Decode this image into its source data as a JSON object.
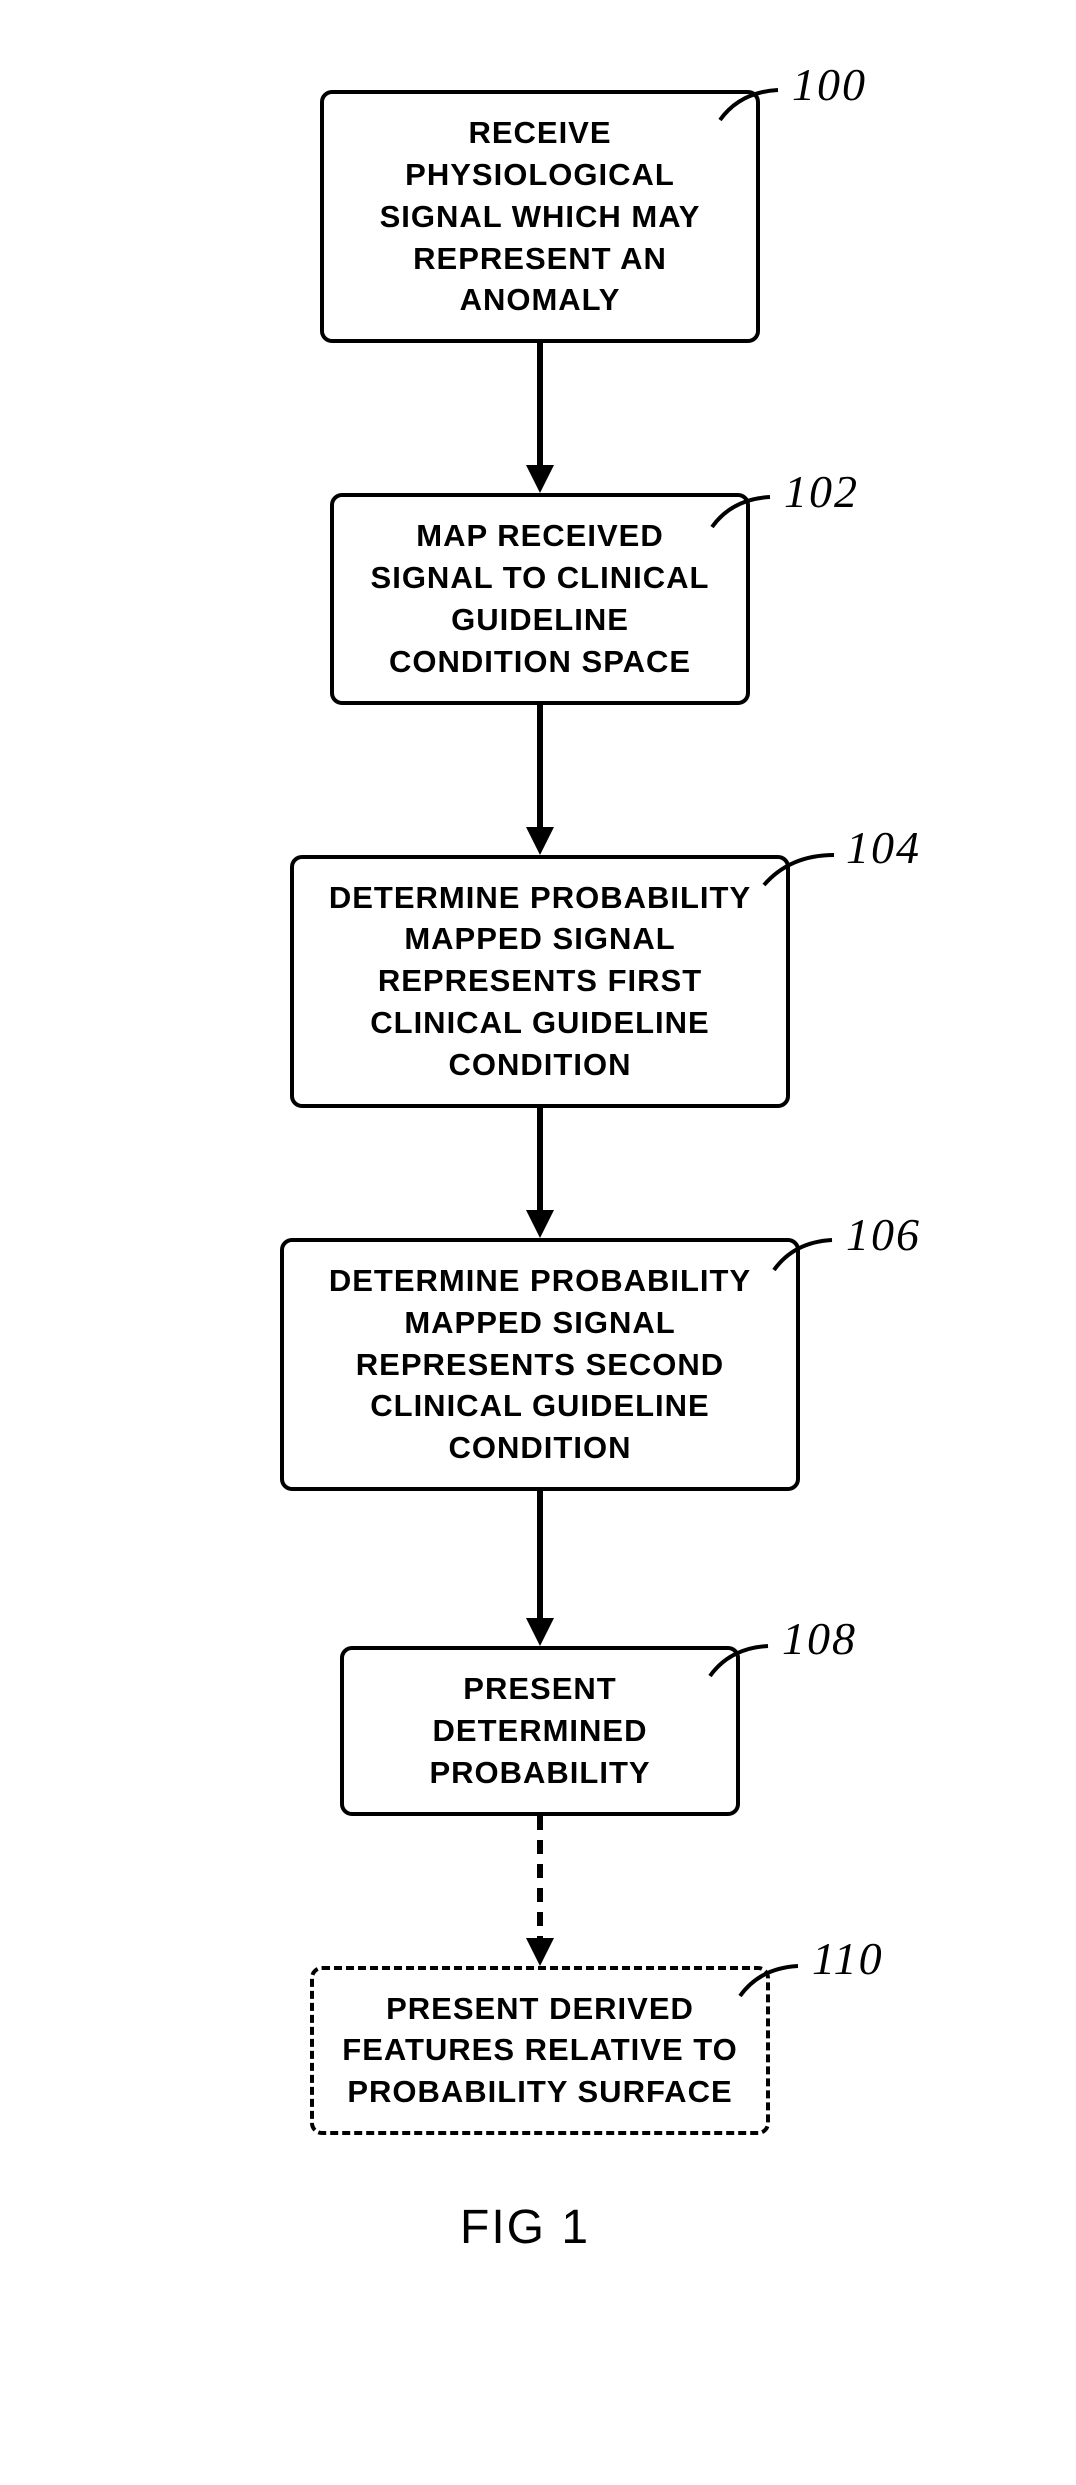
{
  "figure_caption": "FIG 1",
  "nodes": [
    {
      "id": "n100",
      "ref": "100",
      "text": "RECEIVE PHYSIOLOGICAL SIGNAL WHICH  MAY REPRESENT AN ANOMALY",
      "dashed": false
    },
    {
      "id": "n102",
      "ref": "102",
      "text": "MAP RECEIVED SIGNAL TO CLINICAL GUIDELINE CONDITION SPACE",
      "dashed": false
    },
    {
      "id": "n104",
      "ref": "104",
      "text": "DETERMINE PROBABILITY MAPPED SIGNAL REPRESENTS FIRST CLINICAL GUIDELINE CONDITION",
      "dashed": false
    },
    {
      "id": "n106",
      "ref": "106",
      "text": "DETERMINE PROBABILITY MAPPED SIGNAL REPRESENTS SECOND CLINICAL GUIDELINE CONDITION",
      "dashed": false
    },
    {
      "id": "n108",
      "ref": "108",
      "text": "PRESENT DETERMINED PROBABILITY",
      "dashed": false
    },
    {
      "id": "n110",
      "ref": "110",
      "text": "PRESENT DERIVED FEATURES RELATIVE TO PROBABILITY SURFACE",
      "dashed": true
    }
  ],
  "connectors": [
    {
      "from": "n100",
      "to": "n102",
      "dashed": false
    },
    {
      "from": "n102",
      "to": "n104",
      "dashed": false
    },
    {
      "from": "n104",
      "to": "n106",
      "dashed": false
    },
    {
      "from": "n106",
      "to": "n108",
      "dashed": false
    },
    {
      "from": "n108",
      "to": "n110",
      "dashed": true
    }
  ]
}
